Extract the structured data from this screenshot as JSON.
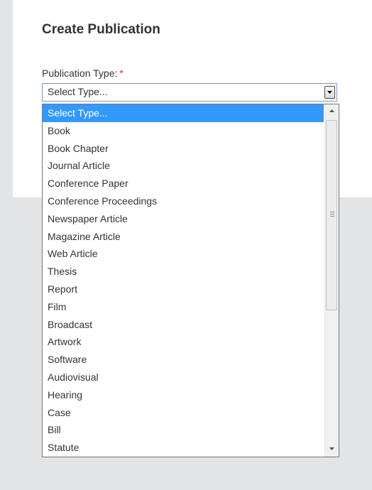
{
  "form": {
    "title": "Create Publication",
    "publication_type_label": "Publication Type:",
    "required_mark": "*",
    "selected_value": "Select Type..."
  },
  "dropdown": {
    "items": [
      "Select Type...",
      "Book",
      "Book Chapter",
      "Journal Article",
      "Conference Paper",
      "Conference Proceedings",
      "Newspaper Article",
      "Magazine Article",
      "Web Article",
      "Thesis",
      "Report",
      "Film",
      "Broadcast",
      "Artwork",
      "Software",
      "Audiovisual",
      "Hearing",
      "Case",
      "Bill",
      "Statute"
    ],
    "highlighted_index": 0
  },
  "colors": {
    "highlight": "#3399ff",
    "required": "#cc3333",
    "page_background": "#e3e4e6"
  }
}
